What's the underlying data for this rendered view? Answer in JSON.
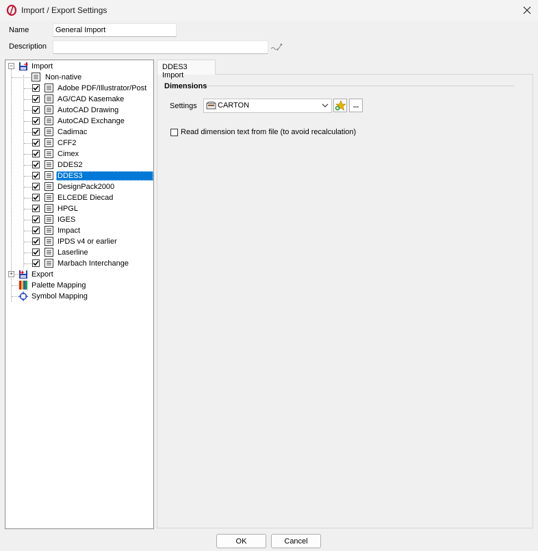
{
  "window": {
    "title": "Import / Export Settings",
    "close_label": "✕"
  },
  "form": {
    "name_label": "Name",
    "name_value": "General Import",
    "description_label": "Description",
    "description_value": ""
  },
  "tree": {
    "import_label": "Import",
    "import_expander": "−",
    "export_label": "Export",
    "export_expander": "+",
    "palette_label": "Palette Mapping",
    "symbol_label": "Symbol Mapping",
    "non_native_label": "Non-native",
    "items": [
      {
        "label": "Adobe PDF/Illustrator/Post",
        "checked": true
      },
      {
        "label": "AG/CAD Kasemake",
        "checked": true
      },
      {
        "label": "AutoCAD Drawing",
        "checked": true
      },
      {
        "label": "AutoCAD Exchange",
        "checked": true
      },
      {
        "label": "Cadimac",
        "checked": true
      },
      {
        "label": "CFF2",
        "checked": true
      },
      {
        "label": "Cimex",
        "checked": true
      },
      {
        "label": "DDES2",
        "checked": true
      },
      {
        "label": "DDES3",
        "checked": true,
        "selected": true
      },
      {
        "label": "DesignPack2000",
        "checked": true
      },
      {
        "label": "ELCEDE Diecad",
        "checked": true
      },
      {
        "label": "HPGL",
        "checked": true
      },
      {
        "label": "IGES",
        "checked": true
      },
      {
        "label": "Impact",
        "checked": true
      },
      {
        "label": "IPDS v4 or earlier",
        "checked": true
      },
      {
        "label": "Laserline",
        "checked": true
      },
      {
        "label": "Marbach Interchange",
        "checked": true
      }
    ]
  },
  "panel": {
    "tab_label": "DDES3 Import",
    "group_title": "Dimensions",
    "settings_label": "Settings",
    "settings_value": "CARTON",
    "more_button_label": "...",
    "read_dim_label": "Read dimension text from file (to avoid recalculation)",
    "read_dim_checked": false
  },
  "buttons": {
    "ok": "OK",
    "cancel": "Cancel"
  },
  "colors": {
    "selection": "#0078d7",
    "brand_red": "#c8102e",
    "accent_star": "#e8b400"
  }
}
